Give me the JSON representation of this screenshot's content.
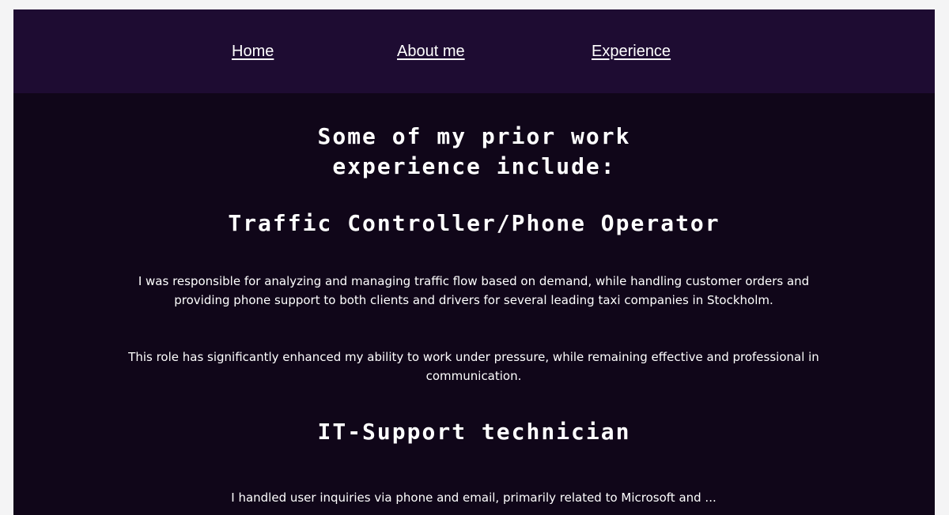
{
  "nav": {
    "home_label": "Home",
    "about_label": "About me",
    "experience_label": "Experience"
  },
  "content": {
    "intro_line1": "Some of my prior work",
    "intro_line2": "experience include:",
    "job1": {
      "title": "Traffic Controller/Phone Operator",
      "paragraph1": "I was responsible for analyzing and managing traffic flow based on demand, while handling customer orders and providing phone support to both clients and drivers for several leading taxi companies in Stockholm.",
      "paragraph2": "This role has significantly enhanced my ability to work under pressure, while remaining effective and professional in communication."
    },
    "job2": {
      "title": "IT-Support technician",
      "paragraph1": "I handled user inquiries via phone and email, primarily related to Microsoft and ..."
    }
  },
  "colors": {
    "page_bg": "#f4f4f5",
    "nav_bg": "#1e0c32",
    "content_bg": "#100619",
    "text": "#ffffff"
  }
}
